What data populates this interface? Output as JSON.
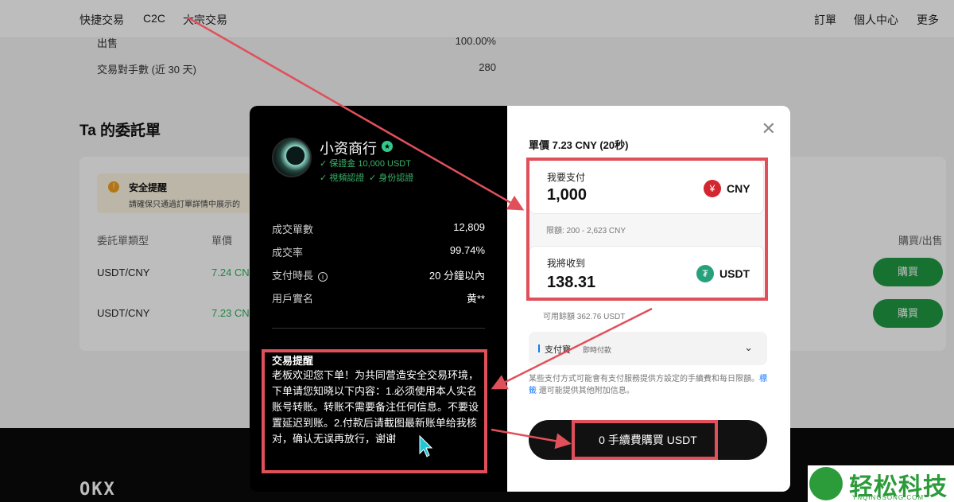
{
  "nav": {
    "items": [
      "快捷交易",
      "C2C",
      "大宗交易"
    ],
    "right_items": [
      "訂單",
      "個人中心",
      "更多"
    ]
  },
  "background": {
    "sell_label": "出售",
    "sell_value": "100.00%",
    "fee_label": "交易對手數 (近 30 天)",
    "fee_value": "280",
    "section_title": "Ta 的委託單",
    "safety_title": "安全提醒",
    "safety_text": "請確保只通過訂單詳情中展示的",
    "columns": [
      "委託單類型",
      "單價",
      "購買/出售"
    ],
    "rows": [
      {
        "pair": "USDT/CNY",
        "price": "7.24 CN",
        "action": "購買"
      },
      {
        "pair": "USDT/CNY",
        "price": "7.23 CN",
        "action": "購買"
      }
    ],
    "footer_logo": "OKX"
  },
  "merchant": {
    "name": "小资商行",
    "deposit": "✓ 保證金 10,000 USDT",
    "cert_video": "✓ 視頻認證",
    "cert_id": "✓ 身份認證",
    "stats": [
      {
        "label": "成交單數",
        "value": "12,809"
      },
      {
        "label": "成交率",
        "value": "99.74%"
      },
      {
        "label": "支付時長",
        "value": "20 分鐘以內"
      },
      {
        "label": "用戶實名",
        "value": "黄**"
      }
    ],
    "notice_title": "交易提醒",
    "notice_text": "老板欢迎您下单！为共同营造安全交易环境，下单请您知晓以下内容：1.必须使用本人实名账号转账。转账不需要备注任何信息。不要设置延迟到账。2.付款后请截图最新账单给我核对，确认无误再放行，谢谢"
  },
  "order": {
    "unit_price": "單價 7.23 CNY (20秒)",
    "pay_label": "我要支付",
    "pay_value": "1,000",
    "pay_currency": "CNY",
    "pay_symbol": "¥",
    "limit": "限額: 200 - 2,623 CNY",
    "receive_label": "我將收到",
    "receive_value": "138.31",
    "receive_currency": "USDT",
    "available": "可用餘額 362.76 USDT",
    "payment_method": "支付寶",
    "payment_sub": "即時付款",
    "payment_note_1": "某些支付方式可能會有支付服務提供方設定的手續費和每日限額。",
    "payment_note_link": "標籤",
    "payment_note_2": " 還可能提供其他附加信息。",
    "buy_button": "0 手續費購買 USDT"
  },
  "watermark": {
    "brand": "轻松科技",
    "url": "YNQINGSONG.COM"
  },
  "colors": {
    "accent_green": "#1f9a43",
    "highlight_red": "#e0505a",
    "price_green": "#2bb35b"
  }
}
